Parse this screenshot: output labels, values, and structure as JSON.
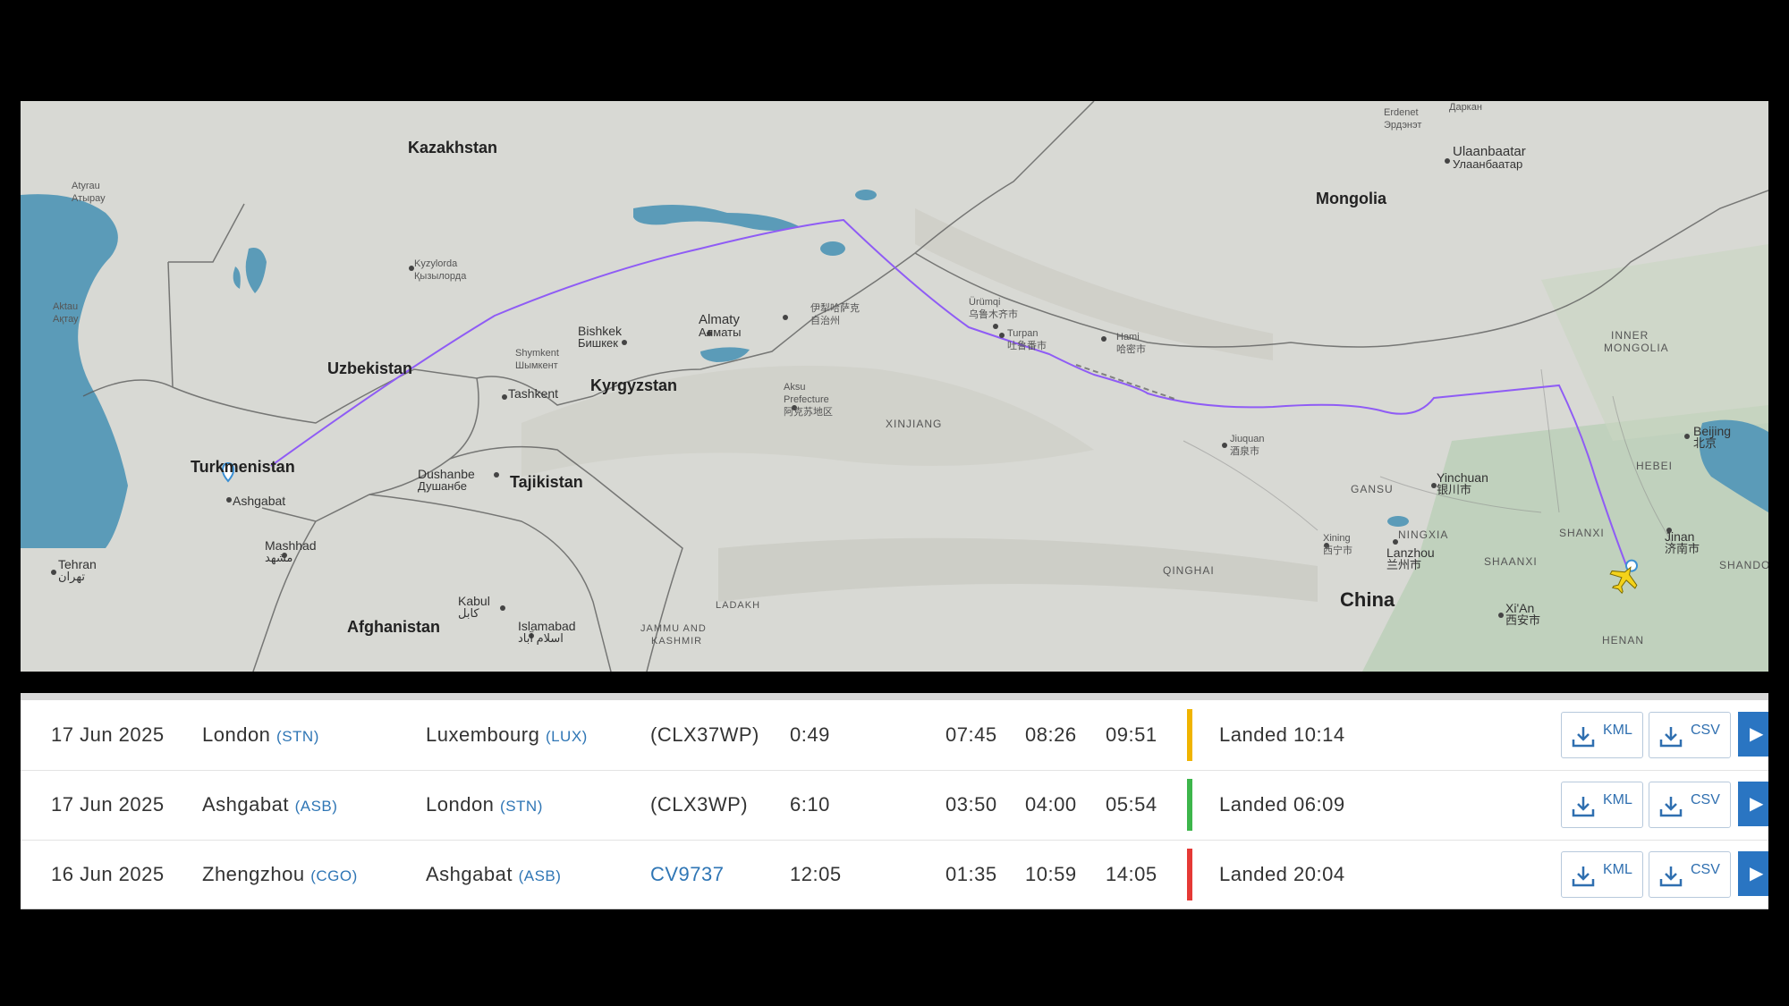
{
  "map": {
    "countries": {
      "kazakhstan": "Kazakhstan",
      "mongolia": "Mongolia",
      "uzbekistan": "Uzbekistan",
      "kyrgyzstan": "Kyrgyzstan",
      "tajikistan": "Tajikistan",
      "turkmenistan": "Turkmenistan",
      "afghanistan": "Afghanistan",
      "china": "China"
    },
    "regions": {
      "xinjiang": "XINJIANG",
      "gansu": "GANSU",
      "ningxia": "NINGXIA",
      "qinghai": "QINGHAI",
      "shaanxi": "SHAANXI",
      "shanxi": "SHANXI",
      "hebei": "HEBEI",
      "henan": "HENAN",
      "shandong": "SHANDO",
      "inner_mongolia_1": "INNER",
      "inner_mongolia_2": "MONGOLIA",
      "ladakh": "LADAKH",
      "jammu_1": "JAMMU AND",
      "jammu_2": "KASHMIR"
    },
    "cities": {
      "atyrau": "Atyrau",
      "atyrau_alt": "Атырау",
      "aktau": "Aktau",
      "aktau_alt": "Ақтау",
      "kyzylorda": "Kyzylorda",
      "kyzylorda_alt": "Қызылорда",
      "shymkent": "Shymkent",
      "shymkent_alt": "Шымкент",
      "tashkent": "Tashkent",
      "bishkek": "Bishkek",
      "bishkek_alt": "Бишкек",
      "almaty": "Almaty",
      "almaty_alt": "Алматы",
      "dushanbe": "Dushanbe",
      "dushanbe_alt": "Душанбе",
      "ashgabat": "Ashgabat",
      "mashhad": "Mashhad",
      "mashhad_alt": "مشهد",
      "tehran": "Tehran",
      "tehran_alt": "تهران",
      "kabul": "Kabul",
      "kabul_alt": "کابل",
      "islamabad": "Islamabad",
      "islamabad_alt": "اسلام آباد",
      "ili": "伊犁哈萨克",
      "ili_alt": "自治州",
      "aksu": "Aksu",
      "aksu_alt": "Prefecture",
      "aksu_alt2": "阿克苏地区",
      "urumqi": "Ürümqi",
      "urumqi_alt": "乌鲁木齐市",
      "turpan": "Turpan",
      "turpan_alt": "吐鲁番市",
      "hami": "Hami",
      "hami_alt": "哈密市",
      "jiuquan": "Jiuquan",
      "jiuquan_alt": "酒泉市",
      "yinchuan": "Yinchuan",
      "yinchuan_alt": "银川市",
      "xining": "Xining",
      "xining_alt": "西宁市",
      "lanzhou": "Lanzhou",
      "lanzhou_alt": "兰州市",
      "xian": "Xi'An",
      "xian_alt": "西安市",
      "beijing": "Beijing",
      "beijing_alt": "北京",
      "jinan": "Jinan",
      "jinan_alt": "济南市",
      "ulaanbaatar": "Ulaanbaatar",
      "ulaanbaatar_alt": "Улаанбаатар",
      "erdenet": "Erdenet",
      "erdenet_alt": "Эрдэнэт",
      "darkhan": "Даркан"
    }
  },
  "flights": [
    {
      "date": "17 Jun 2025",
      "from": "London",
      "from_code": "(STN)",
      "to": "Luxembourg",
      "to_code": "(LUX)",
      "flight": "(CLX37WP)",
      "duration": "0:49",
      "std": "07:45",
      "atd": "08:26",
      "sta": "09:51",
      "status": "Landed 10:14",
      "status_color": "#f0b400",
      "kml_label": "KML",
      "csv_label": "CSV"
    },
    {
      "date": "17 Jun 2025",
      "from": "Ashgabat",
      "from_code": "(ASB)",
      "to": "London",
      "to_code": "(STN)",
      "flight": "(CLX3WP)",
      "duration": "6:10",
      "std": "03:50",
      "atd": "04:00",
      "sta": "05:54",
      "status": "Landed 06:09",
      "status_color": "#3db64b",
      "kml_label": "KML",
      "csv_label": "CSV"
    },
    {
      "date": "16 Jun 2025",
      "from": "Zhengzhou",
      "from_code": "(CGO)",
      "to": "Ashgabat",
      "to_code": "(ASB)",
      "flight": "CV9737",
      "duration": "12:05",
      "std": "01:35",
      "atd": "10:59",
      "sta": "14:05",
      "status": "Landed 20:04",
      "status_color": "#e53935",
      "kml_label": "KML",
      "csv_label": "CSV"
    }
  ],
  "colors": {
    "flight_path": "#8f5cf5",
    "link_blue": "#2f76b5",
    "water": "#5b9bb8",
    "land": "#d8d9d4",
    "play_button": "#2a75c2"
  }
}
